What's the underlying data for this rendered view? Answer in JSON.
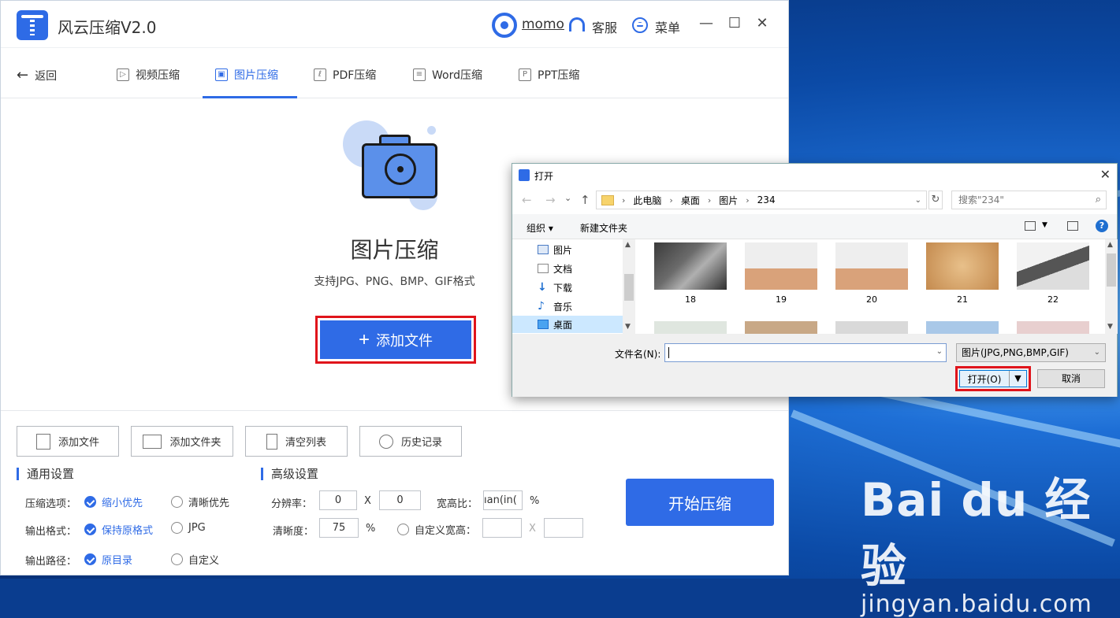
{
  "app": {
    "title": "风云压缩V2.0",
    "user": "momo",
    "support_label": "客服",
    "menu_label": "菜单",
    "minimize": "—",
    "maximize": "☐",
    "close": "✕"
  },
  "nav": {
    "back_label": "返回",
    "tabs": [
      {
        "label": "视频压缩",
        "icon": "video-file-icon"
      },
      {
        "label": "图片压缩",
        "icon": "image-file-icon",
        "active": true
      },
      {
        "label": "PDF压缩",
        "icon": "pdf-file-icon"
      },
      {
        "label": "Word压缩",
        "icon": "word-file-icon"
      },
      {
        "label": "PPT压缩",
        "icon": "ppt-file-icon"
      }
    ]
  },
  "hero": {
    "title": "图片压缩",
    "subtitle": "支持JPG、PNG、BMP、GIF格式",
    "add_button": "添加文件",
    "add_button_icon": "+"
  },
  "toolbar": {
    "add_file": "添加文件",
    "add_folder": "添加文件夹",
    "clear_list": "清空列表",
    "history": "历史记录"
  },
  "general": {
    "title": "通用设置",
    "compress_label": "压缩选项：",
    "compress_options": [
      "缩小优先",
      "清晰优先"
    ],
    "format_label": "输出格式：",
    "format_options": [
      "保持原格式",
      "JPG"
    ],
    "path_label": "输出路径：",
    "path_options": [
      "原目录",
      "自定义"
    ]
  },
  "advanced": {
    "title": "高级设置",
    "resolution_label": "分辨率：",
    "resolution_w": "0",
    "resolution_x": "X",
    "resolution_h": "0",
    "aspect_label": "宽高比：",
    "aspect_value": "ıan(in(",
    "aspect_unit": "%",
    "clarity_label": "清晰度：",
    "clarity_value": "75",
    "clarity_unit": "%",
    "custom_size_label": "自定义宽高：",
    "custom_x": "X"
  },
  "start_button": "开始压缩",
  "dialog": {
    "title": "打开",
    "breadcrumb": [
      "此电脑",
      "桌面",
      "图片",
      "234"
    ],
    "search_placeholder": "搜索\"234\"",
    "organize": "组织 ▾",
    "new_folder": "新建文件夹",
    "help": "?",
    "tree": [
      {
        "label": "图片",
        "icon": "pictures-icon"
      },
      {
        "label": "文档",
        "icon": "documents-icon"
      },
      {
        "label": "下载",
        "icon": "download-icon"
      },
      {
        "label": "音乐",
        "icon": "music-icon"
      },
      {
        "label": "桌面",
        "icon": "desktop-icon",
        "selected": true
      }
    ],
    "files": [
      "18",
      "19",
      "20",
      "21",
      "22"
    ],
    "filename_label": "文件名(N):",
    "filename_value": "",
    "filetype": "图片(JPG,PNG,BMP,GIF)",
    "open_button": "打开(O)",
    "cancel_button": "取消"
  },
  "watermark": {
    "logo": "Bai du 经验",
    "url": "jingyan.baidu.com"
  },
  "colors": {
    "accent": "#2f6be6",
    "highlight_border": "#e0141b"
  }
}
